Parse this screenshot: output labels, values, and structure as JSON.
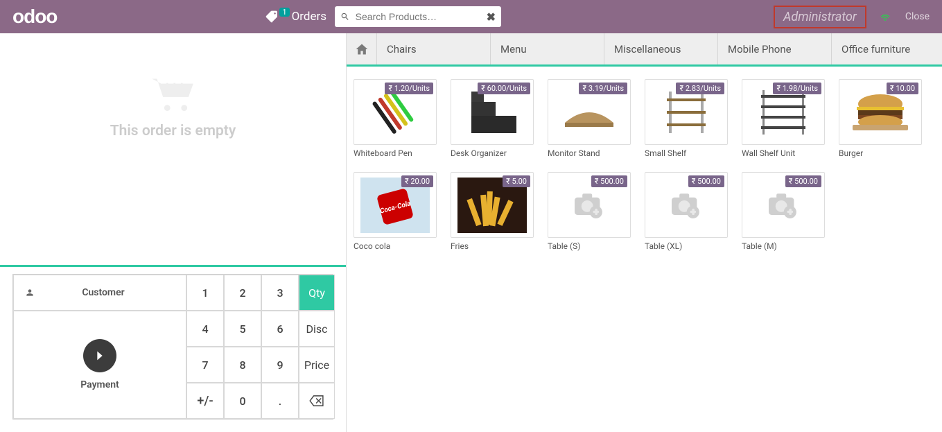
{
  "header": {
    "logo": "odoo",
    "orders_label": "Orders",
    "orders_badge": "1",
    "search_placeholder": "Search Products…",
    "user": "Administrator",
    "close_label": "Close"
  },
  "order": {
    "empty_text": "This order is empty"
  },
  "pad": {
    "customer_label": "Customer",
    "payment_label": "Payment",
    "btn_1": "1",
    "btn_2": "2",
    "btn_3": "3",
    "btn_4": "4",
    "btn_5": "5",
    "btn_6": "6",
    "btn_7": "7",
    "btn_8": "8",
    "btn_9": "9",
    "btn_pm": "+/-",
    "btn_0": "0",
    "btn_dot": ".",
    "mode_qty": "Qty",
    "mode_disc": "Disc",
    "mode_price": "Price"
  },
  "categories": [
    "Chairs",
    "Menu",
    "Miscellaneous",
    "Mobile Phone",
    "Office furniture"
  ],
  "products": [
    {
      "name": "Whiteboard Pen",
      "price": "₹ 1.20/Units",
      "kind": "pens"
    },
    {
      "name": "Desk Organizer",
      "price": "₹ 60.00/Units",
      "kind": "organizer"
    },
    {
      "name": "Monitor Stand",
      "price": "₹ 3.19/Units",
      "kind": "monitorstand"
    },
    {
      "name": "Small Shelf",
      "price": "₹ 2.83/Units",
      "kind": "smallshelf"
    },
    {
      "name": "Wall Shelf Unit",
      "price": "₹ 1.98/Units",
      "kind": "wallshelf"
    },
    {
      "name": "Burger",
      "price": "₹ 10.00",
      "kind": "burger"
    },
    {
      "name": "Coco cola",
      "price": "₹ 20.00",
      "kind": "coke"
    },
    {
      "name": "Fries",
      "price": "₹ 5.00",
      "kind": "fries"
    },
    {
      "name": "Table (S)",
      "price": "₹ 500.00",
      "kind": "placeholder"
    },
    {
      "name": "Table (XL)",
      "price": "₹ 500.00",
      "kind": "placeholder"
    },
    {
      "name": "Table (M)",
      "price": "₹ 500.00",
      "kind": "placeholder"
    }
  ]
}
